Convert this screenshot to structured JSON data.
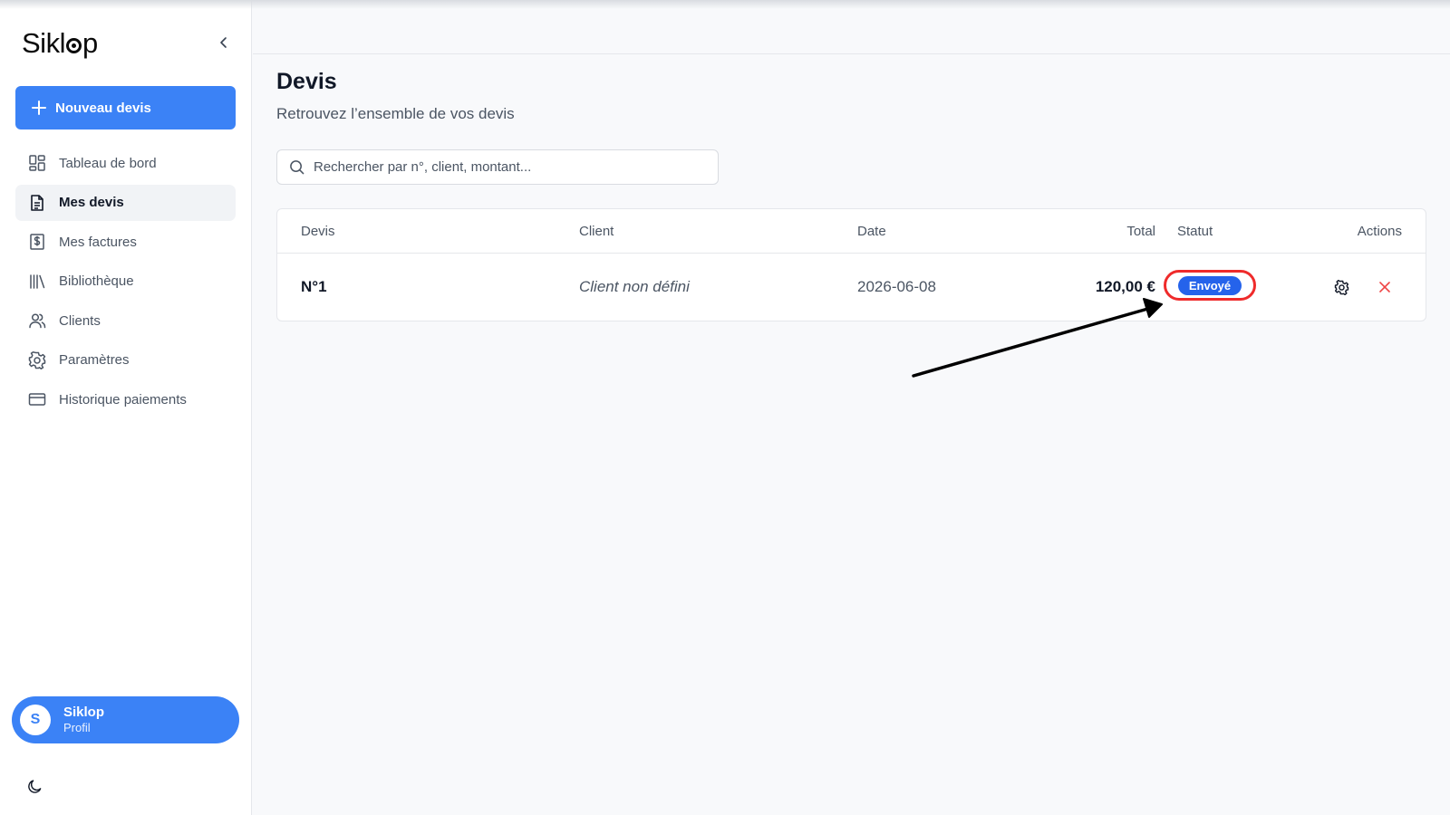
{
  "app": {
    "logo_text_start": "Sikl",
    "logo_text_end": "p"
  },
  "sidebar": {
    "new_button": "Nouveau devis",
    "items": [
      {
        "label": "Tableau de bord",
        "icon": "dashboard-icon"
      },
      {
        "label": "Mes devis",
        "icon": "document-icon",
        "active": true
      },
      {
        "label": "Mes factures",
        "icon": "invoice-icon"
      },
      {
        "label": "Bibliothèque",
        "icon": "library-icon"
      },
      {
        "label": "Clients",
        "icon": "users-icon"
      },
      {
        "label": "Paramètres",
        "icon": "gear-icon"
      },
      {
        "label": "Historique paiements",
        "icon": "credit-card-icon"
      }
    ],
    "profile": {
      "initial": "S",
      "name": "Siklop",
      "subtitle": "Profil"
    }
  },
  "page": {
    "title": "Devis",
    "subtitle": "Retrouvez l’ensemble de vos devis",
    "search_placeholder": "Rechercher par n°, client, montant..."
  },
  "table": {
    "headers": {
      "devis": "Devis",
      "client": "Client",
      "date": "Date",
      "total": "Total",
      "statut": "Statut",
      "actions": "Actions"
    },
    "rows": [
      {
        "number": "N°1",
        "client": "Client non défini",
        "date": "2026-06-08",
        "total": "120,00 €",
        "status": "Envoyé"
      }
    ]
  },
  "colors": {
    "primary": "#3b82f6",
    "badge": "#2563eb",
    "highlight": "#ef2b2b",
    "danger": "#ef4444"
  }
}
